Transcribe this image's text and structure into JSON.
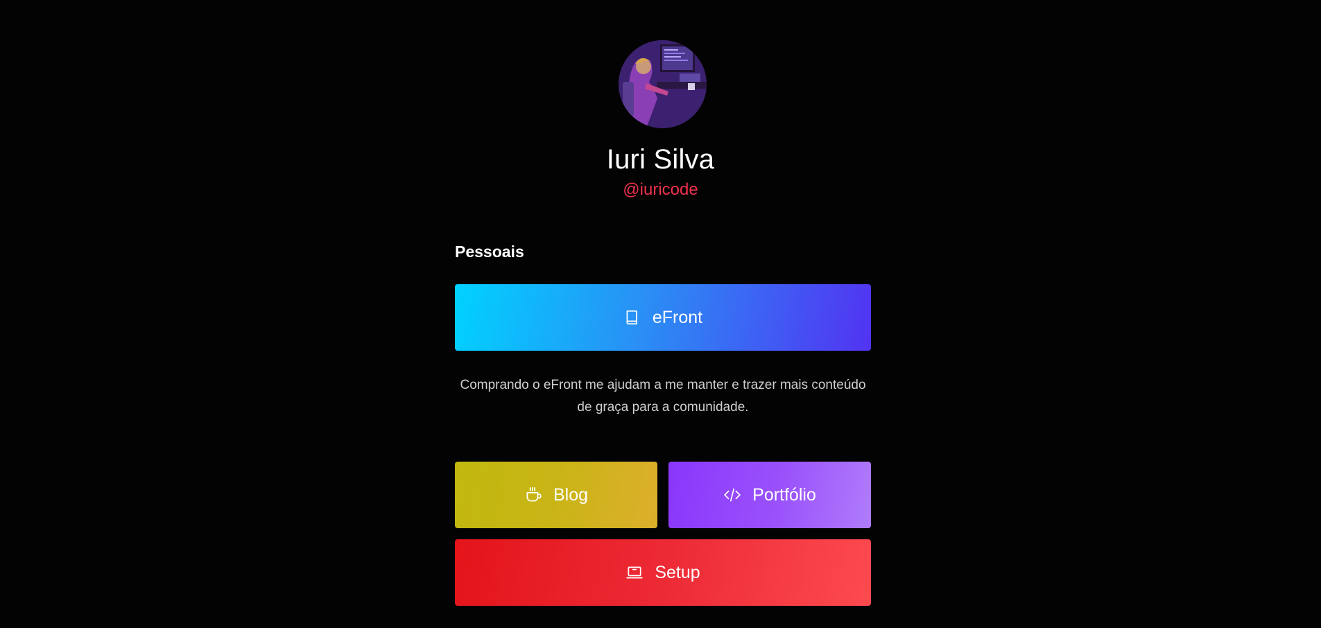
{
  "profile": {
    "name": "Iuri Silva",
    "handle": "@iuricode"
  },
  "sections": {
    "personal_title": "Pessoais"
  },
  "buttons": {
    "efront": {
      "label": "eFront",
      "icon": "book-icon"
    },
    "blog": {
      "label": "Blog",
      "icon": "coffee-cup-icon"
    },
    "portfolio": {
      "label": "Portfólio",
      "icon": "code-icon"
    },
    "setup": {
      "label": "Setup",
      "icon": "laptop-icon"
    }
  },
  "note": "Comprando o eFront me ajudam a me manter e trazer mais conteúdo de graça para a comunidade.",
  "colors": {
    "background": "#040304",
    "handle": "#f0314c",
    "efront_gradient": [
      "#00d2ff",
      "#5233f2"
    ],
    "blog_gradient": [
      "#c1b80f",
      "#ddaf2c"
    ],
    "portfolio_gradient": [
      "#8a36fb",
      "#b07cfb"
    ],
    "setup_gradient": [
      "#e4141a",
      "#fd4a4f"
    ]
  }
}
